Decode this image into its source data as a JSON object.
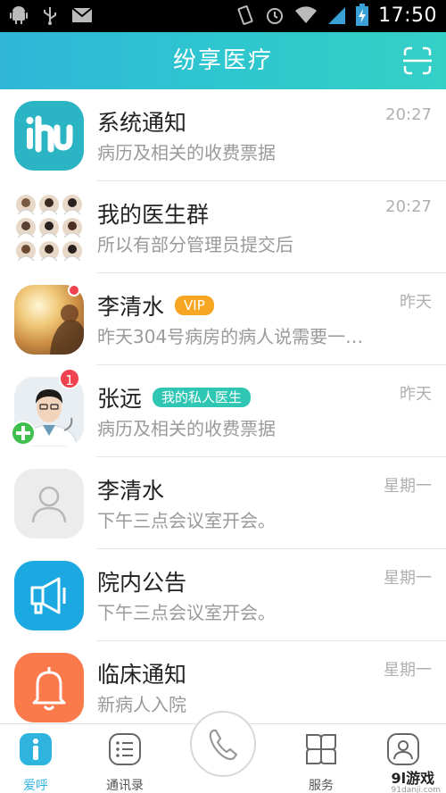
{
  "status_bar": {
    "time": "17:50",
    "icons": [
      "android-icon",
      "usb-icon",
      "mail-icon",
      "vibrate-icon",
      "alarm-icon",
      "wifi-icon",
      "signal-icon",
      "battery-charging-icon"
    ]
  },
  "header": {
    "title": "纷享医疗",
    "right_icon": "scan-icon"
  },
  "conversations": [
    {
      "name": "系统通知",
      "preview": "病历及相关的收费票据",
      "time": "20:27",
      "avatar": "app-logo"
    },
    {
      "name": "我的医生群",
      "preview": "所以有部分管理员提交后",
      "time": "20:27",
      "avatar": "group-grid"
    },
    {
      "name": "李清水",
      "badge": "VIP",
      "preview": "昨天304号病房的病人说需要一…",
      "time": "昨天",
      "avatar": "photo-sunset"
    },
    {
      "name": "张远",
      "badge": "我的私人医生",
      "preview": "病历及相关的收费票据",
      "time": "昨天",
      "avatar": "photo-doctor",
      "unread": "1"
    },
    {
      "name": "李清水",
      "preview": "下午三点会议室开会。",
      "time": "星期一",
      "avatar": "placeholder-person"
    },
    {
      "name": "院内公告",
      "preview": "下午三点会议室开会。",
      "time": "星期一",
      "avatar": "megaphone"
    },
    {
      "name": "临床通知",
      "preview": "新病人入院",
      "time": "星期一",
      "avatar": "bell"
    }
  ],
  "tabs": [
    {
      "label": "爱呼",
      "icon": "info-icon",
      "active": true
    },
    {
      "label": "通讯录",
      "icon": "contacts-icon",
      "active": false
    },
    {
      "label": "服务",
      "icon": "services-icon",
      "active": false
    },
    {
      "label": "",
      "icon": "profile-icon",
      "active": false
    }
  ],
  "call_button": {
    "icon": "phone-icon"
  },
  "watermark": {
    "text": "9l游戏",
    "sub": "91danji.com"
  },
  "colors": {
    "header_start": "#2fb6d9",
    "header_end": "#35d0c5",
    "vip": "#f6a623",
    "doctor_badge": "#2fc7b4",
    "unread": "#f0424f",
    "active_tab": "#2fb4e0"
  }
}
